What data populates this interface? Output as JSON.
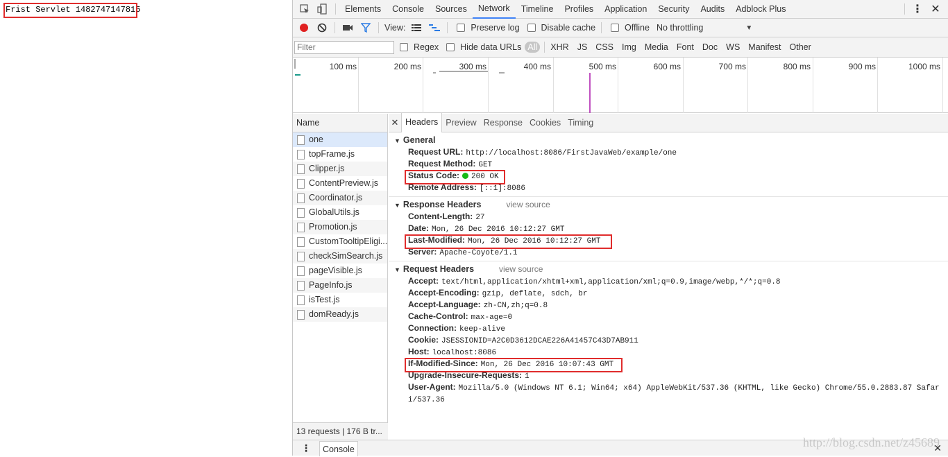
{
  "page": {
    "output_text": "Frist Servlet 1482747147815"
  },
  "devtools": {
    "main_tabs": [
      "Elements",
      "Console",
      "Sources",
      "Network",
      "Timeline",
      "Profiles",
      "Application",
      "Security",
      "Audits",
      "Adblock Plus"
    ],
    "active_tab": "Network",
    "net_toolbar": {
      "view_label": "View:",
      "preserve_log": "Preserve log",
      "disable_cache": "Disable cache",
      "offline": "Offline",
      "throttling": "No throttling"
    },
    "filter": {
      "placeholder": "Filter",
      "regex": "Regex",
      "hide_data_urls": "Hide data URLs",
      "types": [
        "All",
        "XHR",
        "JS",
        "CSS",
        "Img",
        "Media",
        "Font",
        "Doc",
        "WS",
        "Manifest",
        "Other"
      ]
    },
    "overview_ticks": [
      "100 ms",
      "200 ms",
      "300 ms",
      "400 ms",
      "500 ms",
      "600 ms",
      "700 ms",
      "800 ms",
      "900 ms",
      "1000 ms"
    ],
    "requests": {
      "header": "Name",
      "items": [
        "one",
        "topFrame.js",
        "Clipper.js",
        "ContentPreview.js",
        "Coordinator.js",
        "GlobalUtils.js",
        "Promotion.js",
        "CustomTooltipEligi...",
        "checkSimSearch.js",
        "pageVisible.js",
        "PageInfo.js",
        "isTest.js",
        "domReady.js"
      ],
      "status": "13 requests | 176 B tr..."
    },
    "detail_tabs": [
      "Headers",
      "Preview",
      "Response",
      "Cookies",
      "Timing"
    ],
    "general": {
      "title": "General",
      "rows": [
        {
          "key": "Request URL:",
          "value": "http://localhost:8086/FirstJavaWeb/example/one"
        },
        {
          "key": "Request Method:",
          "value": "GET"
        },
        {
          "key": "Status Code:",
          "value": "200 OK"
        },
        {
          "key": "Remote Address:",
          "value": "[::1]:8086"
        }
      ]
    },
    "response_headers": {
      "title": "Response Headers",
      "view_source": "view source",
      "rows": [
        {
          "key": "Content-Length:",
          "value": "27"
        },
        {
          "key": "Date:",
          "value": "Mon, 26 Dec 2016 10:12:27 GMT"
        },
        {
          "key": "Last-Modified:",
          "value": "Mon, 26 Dec 2016 10:12:27 GMT"
        },
        {
          "key": "Server:",
          "value": "Apache-Coyote/1.1"
        }
      ]
    },
    "request_headers": {
      "title": "Request Headers",
      "view_source": "view source",
      "rows": [
        {
          "key": "Accept:",
          "value": "text/html,application/xhtml+xml,application/xml;q=0.9,image/webp,*/*;q=0.8"
        },
        {
          "key": "Accept-Encoding:",
          "value": "gzip, deflate, sdch, br"
        },
        {
          "key": "Accept-Language:",
          "value": "zh-CN,zh;q=0.8"
        },
        {
          "key": "Cache-Control:",
          "value": "max-age=0"
        },
        {
          "key": "Connection:",
          "value": "keep-alive"
        },
        {
          "key": "Cookie:",
          "value": "JSESSIONID=A2C0D3612DCAE226A41457C43D7AB911"
        },
        {
          "key": "Host:",
          "value": "localhost:8086"
        },
        {
          "key": "If-Modified-Since:",
          "value": "Mon, 26 Dec 2016 10:07:43 GMT"
        },
        {
          "key": "Upgrade-Insecure-Requests:",
          "value": "1"
        },
        {
          "key": "User-Agent:",
          "value": "Mozilla/5.0 (Windows NT 6.1; Win64; x64) AppleWebKit/537.36 (KHTML, like Gecko) Chrome/55.0.2883.87 Safar"
        }
      ],
      "user_agent_wrap": "i/537.36"
    },
    "drawer_tab": "Console",
    "watermark": "http://blog.csdn.net/z45689"
  },
  "colors": {
    "record": "#e02020",
    "status_ok": "#18b918",
    "highlight": "#e02c2c",
    "active_tab": "#3e82f7"
  }
}
